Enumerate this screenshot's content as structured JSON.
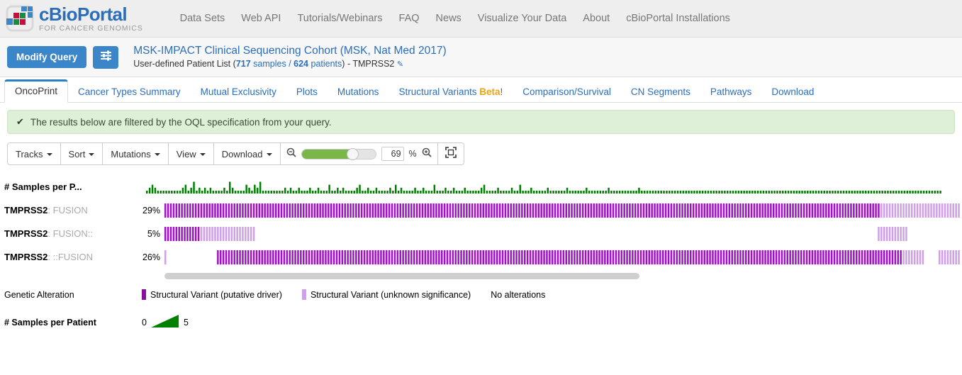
{
  "brand": {
    "name_part1": "cBio",
    "name_part2": "Portal",
    "tagline": "FOR CANCER GENOMICS",
    "logo_icon": "cbioportal-logo-icon",
    "accent_blue": "#2a6ebb"
  },
  "nav": {
    "items": [
      {
        "label": "Data Sets"
      },
      {
        "label": "Web API"
      },
      {
        "label": "Tutorials/Webinars"
      },
      {
        "label": "FAQ"
      },
      {
        "label": "News"
      },
      {
        "label": "Visualize Your Data"
      },
      {
        "label": "About"
      },
      {
        "label": "cBioPortal Installations"
      }
    ]
  },
  "query": {
    "modify_button": "Modify Query",
    "settings_icon": "sliders-icon",
    "study_title": "MSK-IMPACT Clinical Sequencing Cohort (MSK, Nat Med 2017)",
    "list_label": "User-defined Patient List",
    "open_paren": "(",
    "samples_count": "717",
    "samples_word": "samples",
    "separator": "/",
    "patients_count": "624",
    "patients_word": "patients",
    "close_paren": ")",
    "gene_query": "- TMPRSS2",
    "edit_icon": "pencil-icon"
  },
  "tabs": [
    {
      "label": "OncoPrint",
      "active": true
    },
    {
      "label": "Cancer Types Summary",
      "active": false
    },
    {
      "label": "Mutual Exclusivity",
      "active": false
    },
    {
      "label": "Plots",
      "active": false
    },
    {
      "label": "Mutations",
      "active": false
    },
    {
      "label": "Structural Variants",
      "badge": "Beta",
      "badge_suffix": "!",
      "active": false
    },
    {
      "label": "Comparison/Survival",
      "active": false
    },
    {
      "label": "CN Segments",
      "active": false
    },
    {
      "label": "Pathways",
      "active": false
    },
    {
      "label": "Download",
      "active": false
    }
  ],
  "alert": {
    "check_icon": "check-icon",
    "message": "The results below are filtered by the OQL specification from your query.",
    "bg_color": "#dff0d8"
  },
  "toolbar": {
    "tracks_label": "Tracks",
    "sort_label": "Sort",
    "mutations_label": "Mutations",
    "view_label": "View",
    "download_label": "Download",
    "zoom_out_icon": "zoom-out-icon",
    "zoom_in_icon": "zoom-in-icon",
    "expand_icon": "fit-screen-icon",
    "zoom_value": "69",
    "percent_symbol": "%",
    "slider_fill_color": "#7ab648"
  },
  "oncoprint": {
    "header_track_label": "# Samples per P...",
    "tracks": [
      {
        "gene": "TMPRSS2",
        "separator": ": ",
        "alteration": "FUSION",
        "percent": "29%"
      },
      {
        "gene": "TMPRSS2",
        "separator": ": ",
        "alteration": "FUSION::",
        "percent": "5%"
      },
      {
        "gene": "TMPRSS2",
        "separator": ": ",
        "alteration": "::FUSION",
        "percent": "26%"
      }
    ],
    "colors": {
      "driver_purple": "#a211c9",
      "unknown_purple": "#cf9fe8",
      "bar_green": "#008000",
      "scrollbar": "#cfcfcf"
    }
  },
  "legend": {
    "title": "Genetic Alteration",
    "items": [
      {
        "label": "Structural Variant (putative driver)",
        "color": "#8b0c9e",
        "swatch": true
      },
      {
        "label": "Structural Variant (unknown significance)",
        "color": "#cf9fe8",
        "swatch": true
      },
      {
        "label": "No alterations",
        "color": "#ffffff",
        "swatch": false
      }
    ]
  },
  "samples_legend": {
    "title": "# Samples per Patient",
    "min": "0",
    "max": "5",
    "gradient_icon": "green-triangle-gradient",
    "color": "#008000"
  },
  "chart_data": {
    "type": "bar",
    "title": "# Samples per Patient",
    "ylabel": "# Samples",
    "ylim": [
      0,
      5
    ],
    "bar_color": "#008000",
    "values": [
      1,
      2,
      3,
      2,
      1,
      1,
      1,
      1,
      1,
      1,
      1,
      1,
      1,
      2,
      3,
      1,
      2,
      4,
      1,
      2,
      1,
      2,
      1,
      2,
      1,
      1,
      1,
      1,
      2,
      1,
      4,
      2,
      1,
      1,
      1,
      1,
      3,
      2,
      1,
      3,
      2,
      4,
      1,
      1,
      1,
      1,
      1,
      1,
      1,
      1,
      2,
      1,
      2,
      1,
      1,
      2,
      1,
      1,
      1,
      2,
      1,
      1,
      2,
      1,
      1,
      1,
      3,
      1,
      1,
      2,
      1,
      2,
      1,
      1,
      1,
      1,
      2,
      3,
      1,
      1,
      2,
      1,
      1,
      2,
      1,
      1,
      1,
      1,
      2,
      1,
      3,
      1,
      2,
      1,
      1,
      1,
      1,
      2,
      1,
      1,
      2,
      1,
      1,
      1,
      3,
      1,
      1,
      1,
      2,
      1,
      1,
      2,
      1,
      1,
      1,
      2,
      1,
      1,
      1,
      1,
      1,
      2,
      3,
      1,
      1,
      1,
      1,
      2,
      1,
      1,
      1,
      1,
      2,
      1,
      1,
      3,
      1,
      1,
      1,
      2,
      1,
      1,
      1,
      1,
      1,
      2,
      1,
      1,
      1,
      1,
      1,
      1,
      2,
      1,
      1,
      1,
      1,
      1,
      1,
      2,
      1,
      1,
      1,
      1,
      1,
      1,
      1,
      2,
      1,
      1,
      1,
      1,
      1,
      1,
      1,
      1,
      1,
      1,
      2,
      1,
      1,
      1,
      1,
      1,
      1,
      1,
      1,
      1,
      1,
      1,
      1,
      1,
      1,
      1,
      1,
      1,
      1,
      1,
      1,
      1,
      1,
      1,
      1,
      1,
      1,
      1,
      1,
      1,
      1,
      1,
      1,
      1,
      1,
      1,
      1,
      1,
      1,
      1,
      1,
      1,
      1,
      1,
      1,
      1,
      1,
      1,
      1,
      1,
      1,
      1,
      1,
      1,
      1,
      1,
      1,
      1,
      1,
      1,
      1,
      1,
      1,
      1,
      1,
      1,
      1,
      1,
      1,
      1,
      1,
      1,
      1,
      1,
      1,
      1,
      1,
      1,
      1,
      1,
      1,
      1,
      1,
      1,
      1,
      1,
      1,
      1,
      1,
      1,
      1,
      1,
      1,
      1,
      1,
      1,
      1,
      1,
      1,
      1,
      1,
      1,
      1,
      1,
      1,
      1,
      1,
      1,
      1,
      1,
      1,
      1,
      1,
      1,
      1,
      1,
      1,
      1,
      1,
      1,
      1,
      1,
      1,
      1,
      1,
      1,
      1,
      1,
      1,
      1,
      1,
      1,
      1,
      1,
      1,
      1,
      1,
      1,
      1,
      1,
      1,
      1,
      1,
      1,
      1,
      1,
      1,
      1,
      1,
      1,
      1,
      1,
      1,
      1,
      1,
      1,
      1,
      1,
      1,
      1,
      1,
      1,
      1,
      1,
      1,
      1,
      1,
      1,
      1,
      1,
      1,
      1,
      1,
      1,
      1,
      1,
      1,
      1,
      1,
      1,
      1,
      1,
      1,
      1,
      1,
      1,
      1,
      1,
      1,
      1,
      1,
      1,
      1,
      1,
      1,
      1,
      1,
      1,
      1,
      1,
      1,
      1,
      1,
      1,
      1,
      1,
      1,
      1,
      1,
      1,
      1,
      1,
      1,
      1,
      1,
      1,
      1,
      1,
      1,
      1,
      1,
      1,
      1,
      1,
      1,
      1,
      1,
      1,
      1,
      1
    ]
  }
}
